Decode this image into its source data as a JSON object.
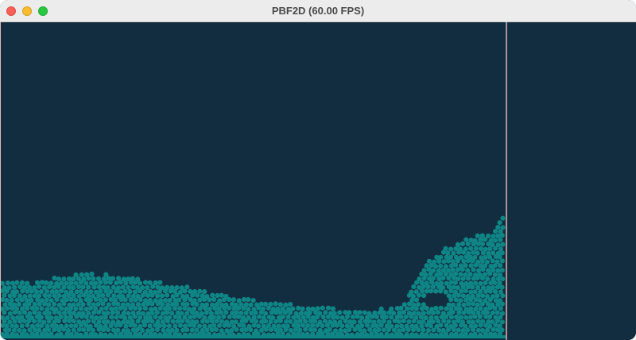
{
  "window": {
    "title": "PBF2D (60.00 FPS)",
    "buttons": {
      "close_color": "#fe5f57",
      "minimize_color": "#febc2e",
      "zoom_color": "#28c840"
    }
  },
  "simulation": {
    "background_color": "#122d40",
    "boundary_color": "#e0b8b0",
    "particle_color": "#0f8585"
  }
}
